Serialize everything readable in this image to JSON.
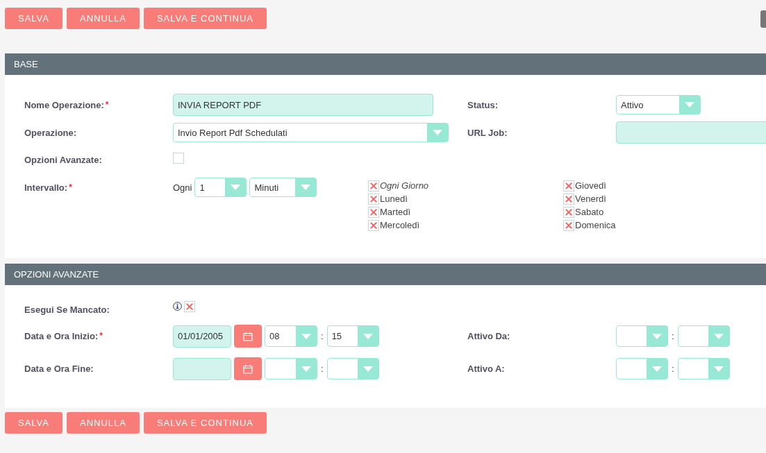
{
  "toolbar_top": {
    "buttons": [
      {
        "label": "SALVA"
      },
      {
        "label": "ANNULLA"
      },
      {
        "label": "SALVA E CONTINUA"
      }
    ]
  },
  "base": {
    "title": "BASE",
    "nome_operazione": {
      "label": "Nome Operazione:",
      "required_mark": "*",
      "value": "INVIA REPORT PDF"
    },
    "status": {
      "label": "Status:",
      "value": "Attivo"
    },
    "operazione": {
      "label": "Operazione:",
      "value": "Invio Report Pdf Schedulati"
    },
    "url_job": {
      "label": "URL Job:"
    },
    "opzioni_avanzate": {
      "label": "Opzioni Avanzate:",
      "checked": false
    },
    "intervallo": {
      "label": "Intervallo:",
      "required_mark": "*",
      "prefix": "Ogni",
      "count": "1",
      "unit": "Minuti",
      "days": [
        {
          "kind": "all",
          "label": "Ogni Giorno",
          "checked": true
        },
        {
          "kind": "day",
          "label": "Lunedì",
          "checked": true
        },
        {
          "kind": "day",
          "label": "Martedì",
          "checked": true
        },
        {
          "kind": "day",
          "label": "Mercoledì",
          "checked": true
        },
        {
          "kind": "day",
          "label": "Giovedì",
          "checked": true
        },
        {
          "kind": "day",
          "label": "Venerdì",
          "checked": true
        },
        {
          "kind": "day",
          "label": "Sabato",
          "checked": true
        },
        {
          "kind": "day",
          "label": "Domenica",
          "checked": true
        }
      ]
    }
  },
  "opzioni_avanzate": {
    "title": "OPZIONI AVANZATE",
    "esegui_se_mancato": {
      "label": "Esegui Se Mancato:",
      "checked": true
    },
    "data_ora_inizio": {
      "label": "Data e Ora Inizio:",
      "required_mark": "*",
      "date": "01/01/2005",
      "hour": "08",
      "separator": ":",
      "minute": "15"
    },
    "attivo_da": {
      "label": "Attivo Da:",
      "separator": ":"
    },
    "data_ora_fine": {
      "label": "Data e Ora Fine:",
      "separator": ":"
    },
    "attivo_a": {
      "label": "Attivo A:",
      "separator": ":"
    }
  },
  "toolbar_bottom": {
    "buttons": [
      {
        "label": "SALVA"
      },
      {
        "label": "ANNULLA"
      },
      {
        "label": "SALVA E CONTINUA"
      }
    ]
  }
}
